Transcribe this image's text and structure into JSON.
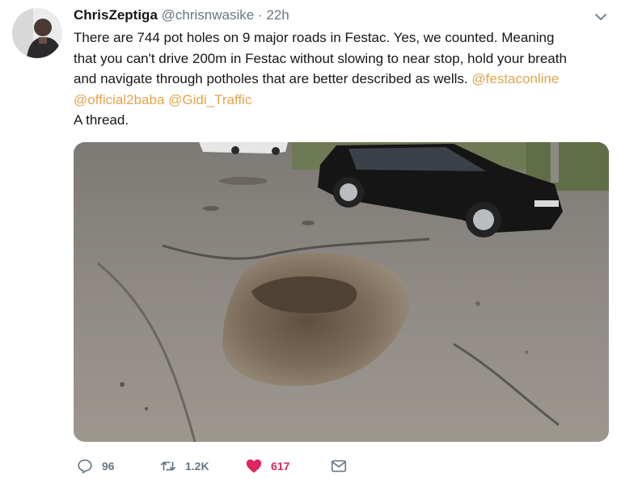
{
  "tweet": {
    "display_name": "ChrisZeptiga",
    "handle": "@chrisnwasike",
    "separator": "·",
    "time": "22h",
    "text_lines": [
      "There are 744 pot holes on 9 major roads in Festac. Yes, we counted. Meaning",
      "that you can't drive 200m in Festac without slowing to near stop, hold your breath",
      "and navigate through potholes that are better described as wells."
    ],
    "mentions": [
      "@festaconline",
      "@official2baba",
      "@Gidi_Traffic"
    ],
    "closing_line": "A thread.",
    "actions": {
      "reply_count": "96",
      "retweet_count": "1.2K",
      "like_count": "617"
    }
  },
  "colors": {
    "text": "#14171a",
    "secondary": "#657786",
    "mention": "#e4a44b",
    "like": "#e0245e"
  },
  "icons": [
    "chevron-down-icon",
    "reply-icon",
    "retweet-icon",
    "heart-icon",
    "mail-icon"
  ]
}
